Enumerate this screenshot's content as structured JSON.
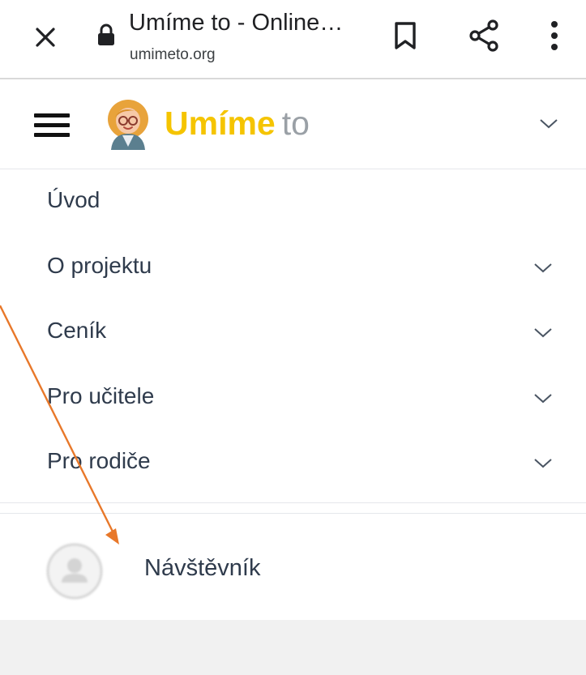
{
  "browser": {
    "page_title": "Umíme to - Online…",
    "url": "umimeto.org",
    "icons": {
      "close": "close-icon",
      "lock": "lock-icon",
      "bookmark": "bookmark-icon",
      "share": "share-icon",
      "more": "more-vert-icon"
    }
  },
  "site": {
    "logo_bold": "Umíme",
    "logo_light": "to",
    "colors": {
      "logo_yellow": "#f5c400",
      "logo_grey": "#9aa0a6",
      "annotation_arrow": "#e8782a"
    }
  },
  "menu": {
    "items": [
      {
        "label": "Úvod",
        "has_submenu": false
      },
      {
        "label": "O projektu",
        "has_submenu": true
      },
      {
        "label": "Ceník",
        "has_submenu": true
      },
      {
        "label": "Pro učitele",
        "has_submenu": true
      },
      {
        "label": "Pro rodiče",
        "has_submenu": true
      }
    ]
  },
  "user": {
    "name": "Návštěvník"
  }
}
